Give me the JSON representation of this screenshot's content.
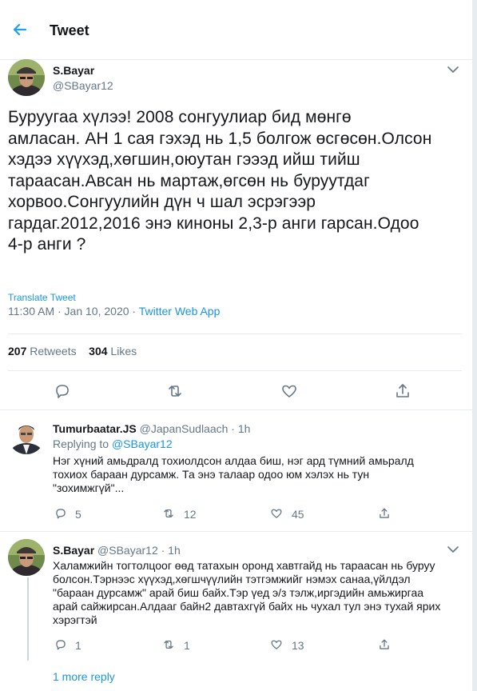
{
  "header": {
    "title": "Tweet",
    "back_icon": "arrow-left-icon"
  },
  "tweet": {
    "author_name": "S.Bayar",
    "author_handle": "@SBayar12",
    "text_lines": [
      "Буруугаа хүлээ! 2008 сонгуулиар бид мөнгө",
      "амласан. АН 1 сая гэхэд нь 1,5 болгож өсгөсөн.Олсон",
      "хэдээ хүүхэд,хөгшин,оюутан гэээд ийш тийш",
      "тараасан.Авсан нь мартаж,өгсөн нь буруутдаг",
      "хорвоо.Сонгуулийн дүн ч шал эсрэгээр",
      "гардаг.2012,2016 энэ киноны 2,3-р анги гарсан.Одоо",
      "4-р анги ?"
    ],
    "translate_label": "Translate Tweet",
    "timestamp": "11:30 AM · Jan 10, 2020 · ",
    "source_app": "Twitter Web App",
    "retweets_count": "207",
    "retweets_label": " Retweets",
    "likes_count": "304",
    "likes_label": " Likes"
  },
  "replies": [
    {
      "author_name": "Tumurbaatar.JS",
      "author_handle": "@JapanSudlaach · 1h",
      "replying_prefix": "Replying to ",
      "replying_to": "@SBayar12",
      "text_lines": [
        "Нэг хүний амьдралд тохиолдсон алдаа биш, нэг ард түмний амьралд",
        "тохиох бараан дурсамж. Та энэ талаар одоо юм хэлэх нь тун",
        "\"зохимжгүй\"..."
      ],
      "replies": "5",
      "retweets": "12",
      "likes": "45"
    },
    {
      "author_name": "S.Bayar",
      "author_handle": "@SBayar12 · 1h",
      "text_lines": [
        "Халамжийн тогтолцоог өөд татахын оронд хавтгайд нь тараасан нь буруу",
        "болсон.Тэрнээс хүүхэд,хөгшчүүлийн тэтгэмжийг нэмэх санаа,үйлдэл",
        "\"бараан дурсамж\" арай биш байх.Тэр үед э/з тэлж,иргэдийн амьжиргаа",
        "арай сайжирсан.Алдааг байн2 давтахгүй байх нь чухал тул энэ тухай ярих",
        "хэрэгтэй"
      ],
      "replies": "1",
      "retweets": "1",
      "likes": "13"
    }
  ],
  "more_replies_label": "1 more reply",
  "colors": {
    "accent": "#1da1f2",
    "link": "#1b95e0",
    "secondary_text": "#657786",
    "border": "#e6ecf0"
  }
}
